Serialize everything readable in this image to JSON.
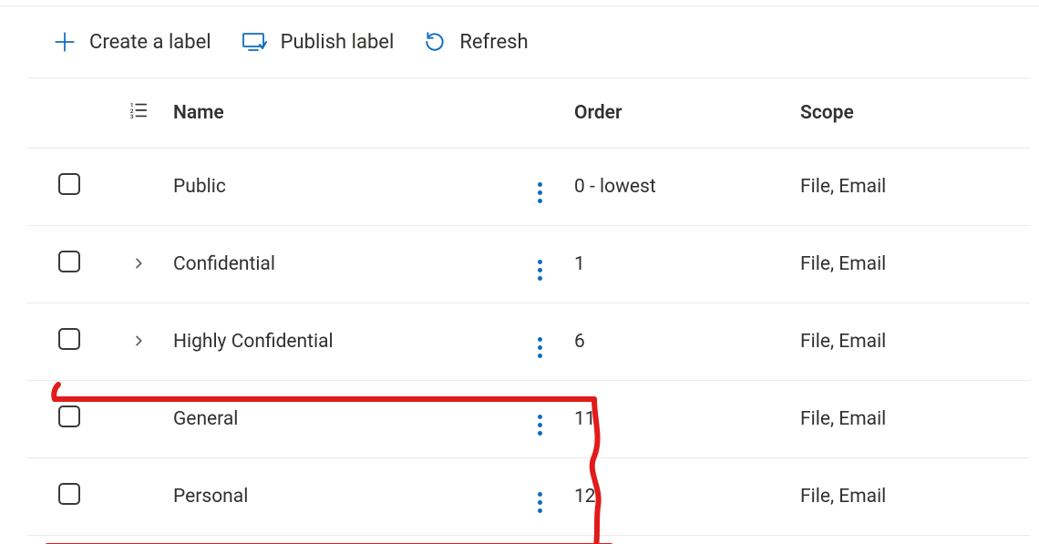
{
  "toolbar": {
    "create_label": "Create a label",
    "publish_label": "Publish label",
    "refresh_label": "Refresh"
  },
  "table": {
    "columns": {
      "name": "Name",
      "order": "Order",
      "scope": "Scope"
    },
    "rows": [
      {
        "name": "Public",
        "order": "0 - lowest",
        "scope": "File, Email",
        "expandable": false
      },
      {
        "name": "Confidential",
        "order": "1",
        "scope": "File, Email",
        "expandable": true
      },
      {
        "name": "Highly Confidential",
        "order": "6",
        "scope": "File, Email",
        "expandable": true
      },
      {
        "name": "General",
        "order": "11",
        "scope": "File, Email",
        "expandable": false
      },
      {
        "name": "Personal",
        "order": "12",
        "scope": "File, Email",
        "expandable": false
      }
    ]
  },
  "annotation": {
    "highlighted_rows": [
      3,
      4
    ]
  }
}
